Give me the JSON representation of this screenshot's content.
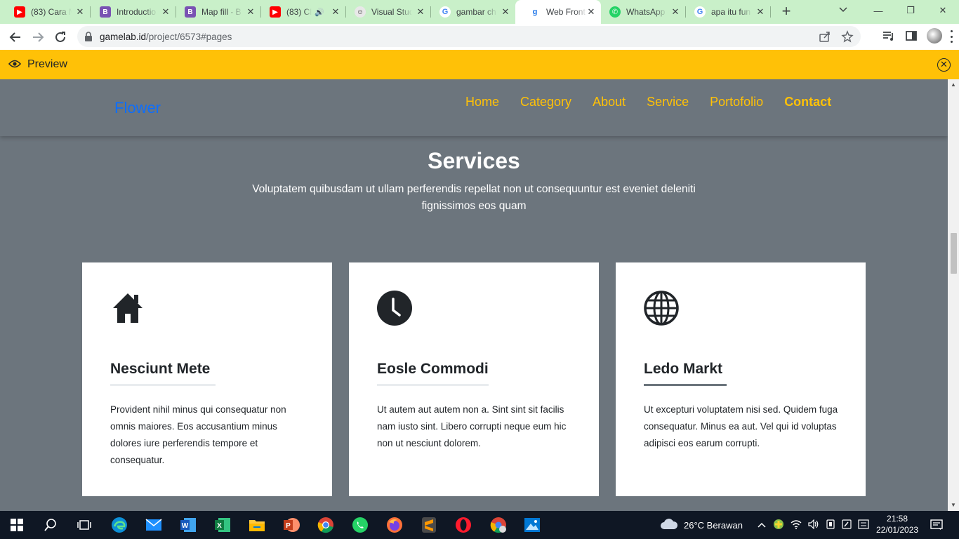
{
  "browser": {
    "tabs": [
      {
        "title": "(83) Cara M",
        "icon": "youtube-icon"
      },
      {
        "title": "Introductio",
        "icon": "bootstrap-icon"
      },
      {
        "title": "Map fill · B",
        "icon": "bootstrap-icon"
      },
      {
        "title": "(83) Cl",
        "icon": "youtube-icon"
      },
      {
        "title": "Visual Stud",
        "icon": "github-icon"
      },
      {
        "title": "gambar ch",
        "icon": "google-icon"
      },
      {
        "title": "Web Front",
        "icon": "gamelab-icon"
      },
      {
        "title": "WhatsApp",
        "icon": "whatsapp-icon"
      },
      {
        "title": "apa itu fun",
        "icon": "google-icon"
      }
    ],
    "url_host": "gamelab.id",
    "url_path": "/project/6573#pages"
  },
  "preview_bar": {
    "label": "Preview"
  },
  "site": {
    "brand": "Flower",
    "menu": [
      {
        "label": "Home"
      },
      {
        "label": "Category"
      },
      {
        "label": "About"
      },
      {
        "label": "Service"
      },
      {
        "label": "Portofolio"
      },
      {
        "label": "Contact"
      }
    ],
    "services": {
      "title": "Services",
      "subtitle": "Voluptatem quibusdam ut ullam perferendis repellat non ut consequuntur est eveniet deleniti fignissimos eos quam",
      "cards": [
        {
          "icon": "house-icon",
          "title": "Nesciunt Mete",
          "text": "Provident nihil minus qui consequatur non omnis maiores. Eos accusantium minus dolores iure perferendis tempore et consequatur."
        },
        {
          "icon": "clock-icon",
          "title": "Eosle Commodi",
          "text": "Ut autem aut autem non a. Sint sint sit facilis nam iusto sint. Libero corrupti neque eum hic non ut nesciunt dolorem."
        },
        {
          "icon": "globe-icon",
          "title": "Ledo Markt",
          "text": "Ut excepturi voluptatem nisi sed. Quidem fuga consequatur. Minus ea aut. Vel qui id voluptas adipisci eos earum corrupti."
        }
      ]
    }
  },
  "taskbar": {
    "weather": "26°C  Berawan",
    "time": "21:58",
    "date": "22/01/2023"
  },
  "colors": {
    "accent": "#ffc107",
    "brand": "#0d6efd",
    "page_bg": "#6c757d",
    "tab_strip": "#c9f0c9"
  }
}
